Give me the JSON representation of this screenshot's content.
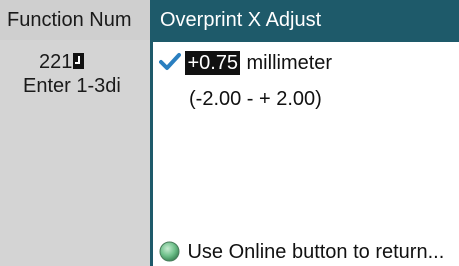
{
  "background_screen": {
    "title": "Function Num",
    "value": "221",
    "hint": "Enter 1-3di"
  },
  "popup": {
    "title": "Overprint X Adjust",
    "value": "+0.75",
    "unit": "millimeter",
    "range": "(-2.00  -  + 2.00)",
    "footer": "Use Online button to return..."
  },
  "icons": {
    "check": "checkmark-icon",
    "online": "online-button-icon",
    "cursor": "enter-cursor-icon"
  },
  "colors": {
    "header_teal": "#1e5a6a",
    "check_blue": "#2a7fc0",
    "online_green": "#6ec08a",
    "background_gray": "#d4d4d4"
  }
}
